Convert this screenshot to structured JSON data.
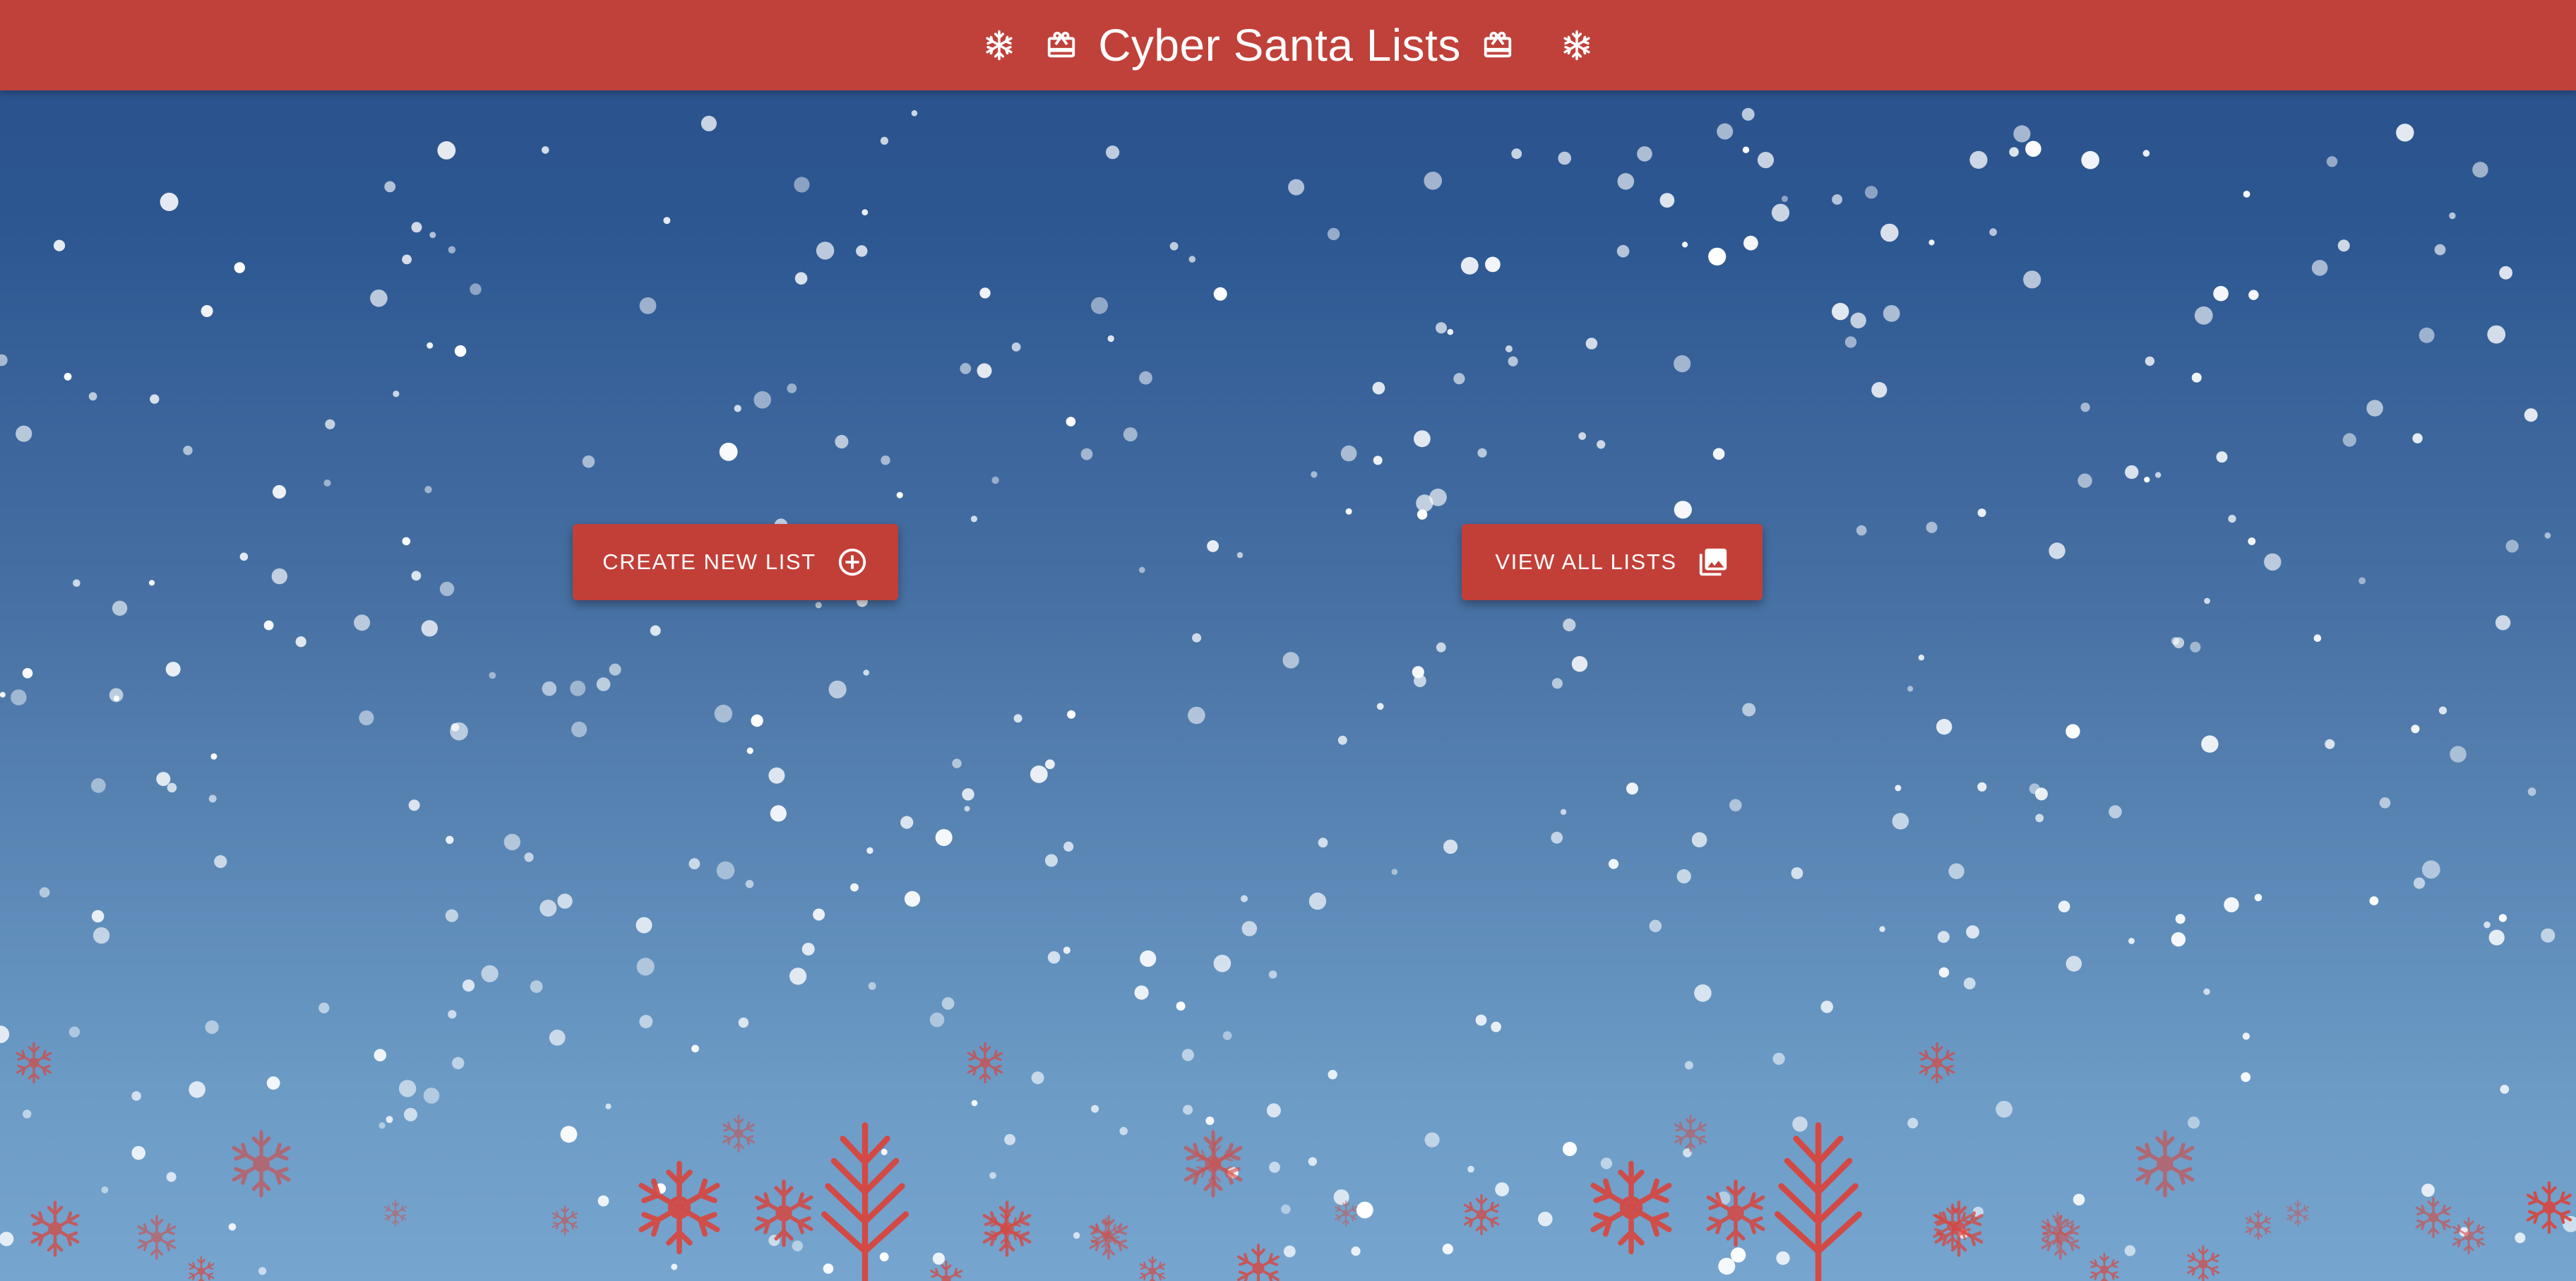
{
  "header": {
    "title": "Cyber Santa Lists",
    "icons": [
      "snowflake-icon",
      "gift-icon",
      "gift-icon",
      "snowflake-icon"
    ],
    "background_color": "#c0403a"
  },
  "actions": {
    "create_label": "CREATE NEW LIST",
    "create_icon": "add-circle-icon",
    "view_label": "VIEW ALL LISTS",
    "view_icon": "photo-library-icon"
  },
  "theme": {
    "accent": "#c23f38",
    "sky_top": "#29518b",
    "sky_bottom": "#76a5cf",
    "snow": "#ffffff",
    "decor_flakes": "#d9453d"
  }
}
